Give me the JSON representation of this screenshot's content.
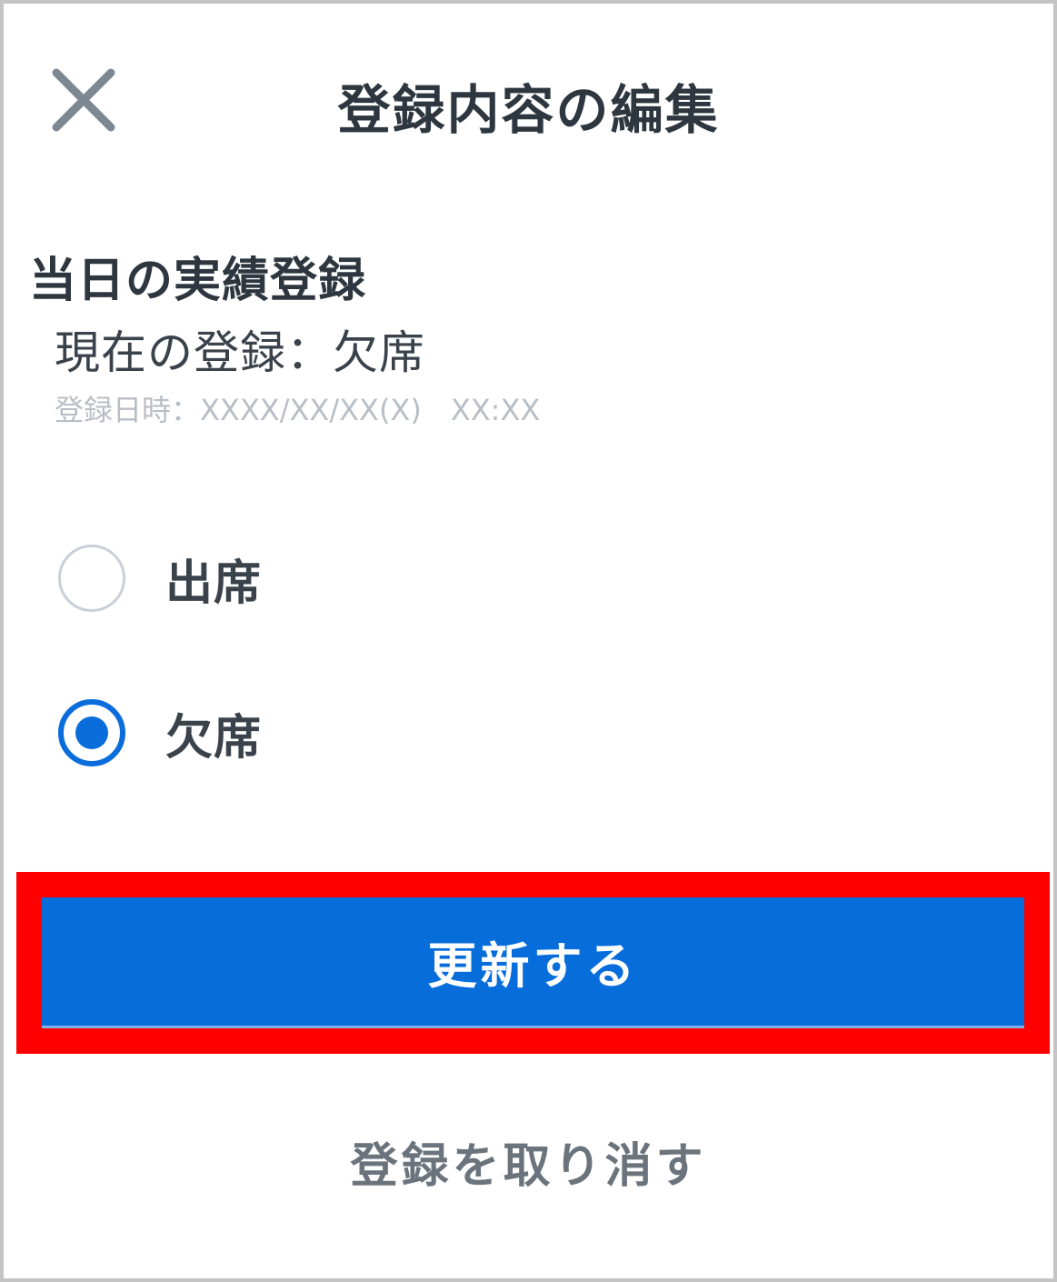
{
  "header": {
    "title": "登録内容の編集",
    "close_icon": "close-icon"
  },
  "section": {
    "heading": "当日の実績登録",
    "current_status": "現在の登録：欠席",
    "registered_at": "登録日時：XXXX/XX/XX(X)　XX:XX"
  },
  "attendance": {
    "options": [
      {
        "label": "出席",
        "checked": false
      },
      {
        "label": "欠席",
        "checked": true
      }
    ],
    "selected": "欠席"
  },
  "actions": {
    "update_label": "更新する",
    "cancel_label": "登録を取り消す"
  },
  "colors": {
    "accent": "#066ddb",
    "highlight": "#ff0000",
    "text_primary": "#2e3740",
    "text_muted": "#b8bec5"
  }
}
